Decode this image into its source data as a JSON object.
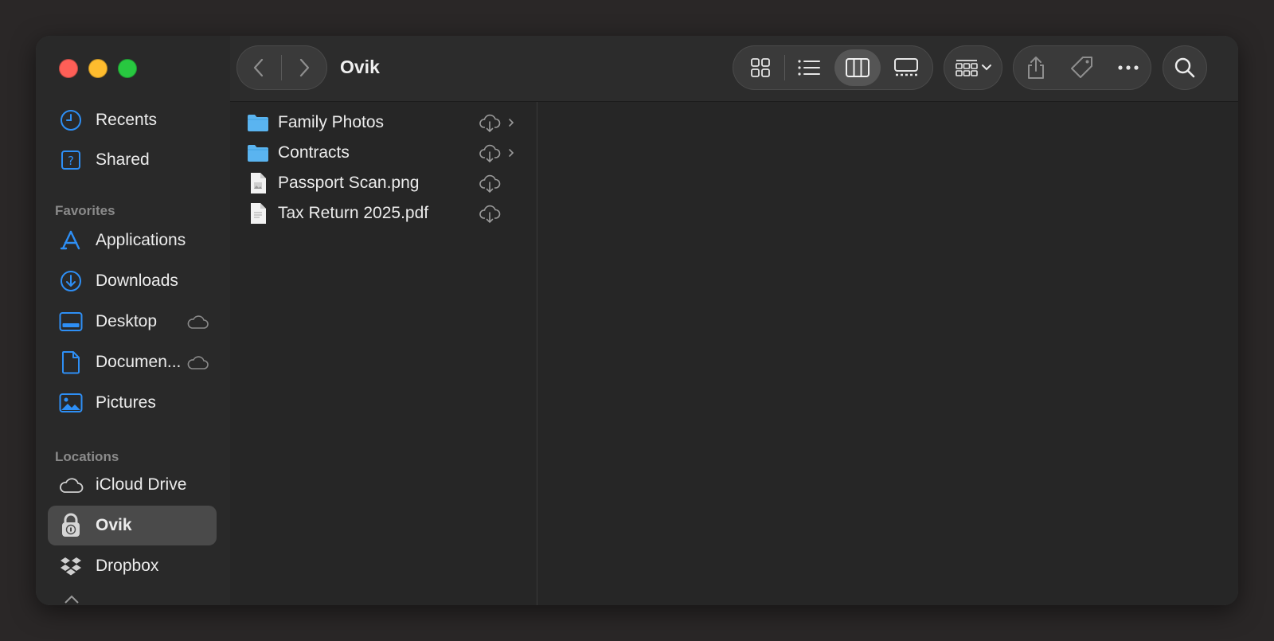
{
  "window": {
    "title": "Ovik"
  },
  "sidebar": {
    "top_items": [
      {
        "label": "Recents",
        "icon": "clock-icon"
      },
      {
        "label": "Shared",
        "icon": "shared-icon"
      }
    ],
    "favorites_header": "Favorites",
    "favorites": [
      {
        "label": "Applications",
        "icon": "applications-icon"
      },
      {
        "label": "Downloads",
        "icon": "downloads-icon"
      },
      {
        "label": "Desktop",
        "icon": "desktop-icon",
        "cloud": true
      },
      {
        "label": "Documen...",
        "icon": "document-icon",
        "cloud": true
      },
      {
        "label": "Pictures",
        "icon": "pictures-icon"
      }
    ],
    "locations_header": "Locations",
    "locations": [
      {
        "label": "iCloud Drive",
        "icon": "icloud-icon"
      },
      {
        "label": "Ovik",
        "icon": "lock-volume-icon",
        "selected": true
      },
      {
        "label": "Dropbox",
        "icon": "dropbox-icon"
      }
    ]
  },
  "files": [
    {
      "name": "Family Photos",
      "kind": "folder",
      "has_children": true
    },
    {
      "name": "Contracts",
      "kind": "folder",
      "has_children": true
    },
    {
      "name": "Passport Scan.png",
      "kind": "image",
      "has_children": false
    },
    {
      "name": "Tax Return 2025.pdf",
      "kind": "pdf",
      "has_children": false
    }
  ],
  "toolbar": {
    "icons": [
      "back-icon",
      "forward-icon",
      "icon-view-icon",
      "list-view-icon",
      "column-view-icon",
      "gallery-view-icon",
      "group-icon",
      "share-icon",
      "tag-icon",
      "more-icon",
      "search-icon"
    ],
    "active_view": "column"
  },
  "colors": {
    "accent": "#2e8ff5",
    "folder": "#5ab4f0",
    "close": "#fe5f57",
    "minimize": "#febc2e",
    "zoom": "#28c840"
  }
}
